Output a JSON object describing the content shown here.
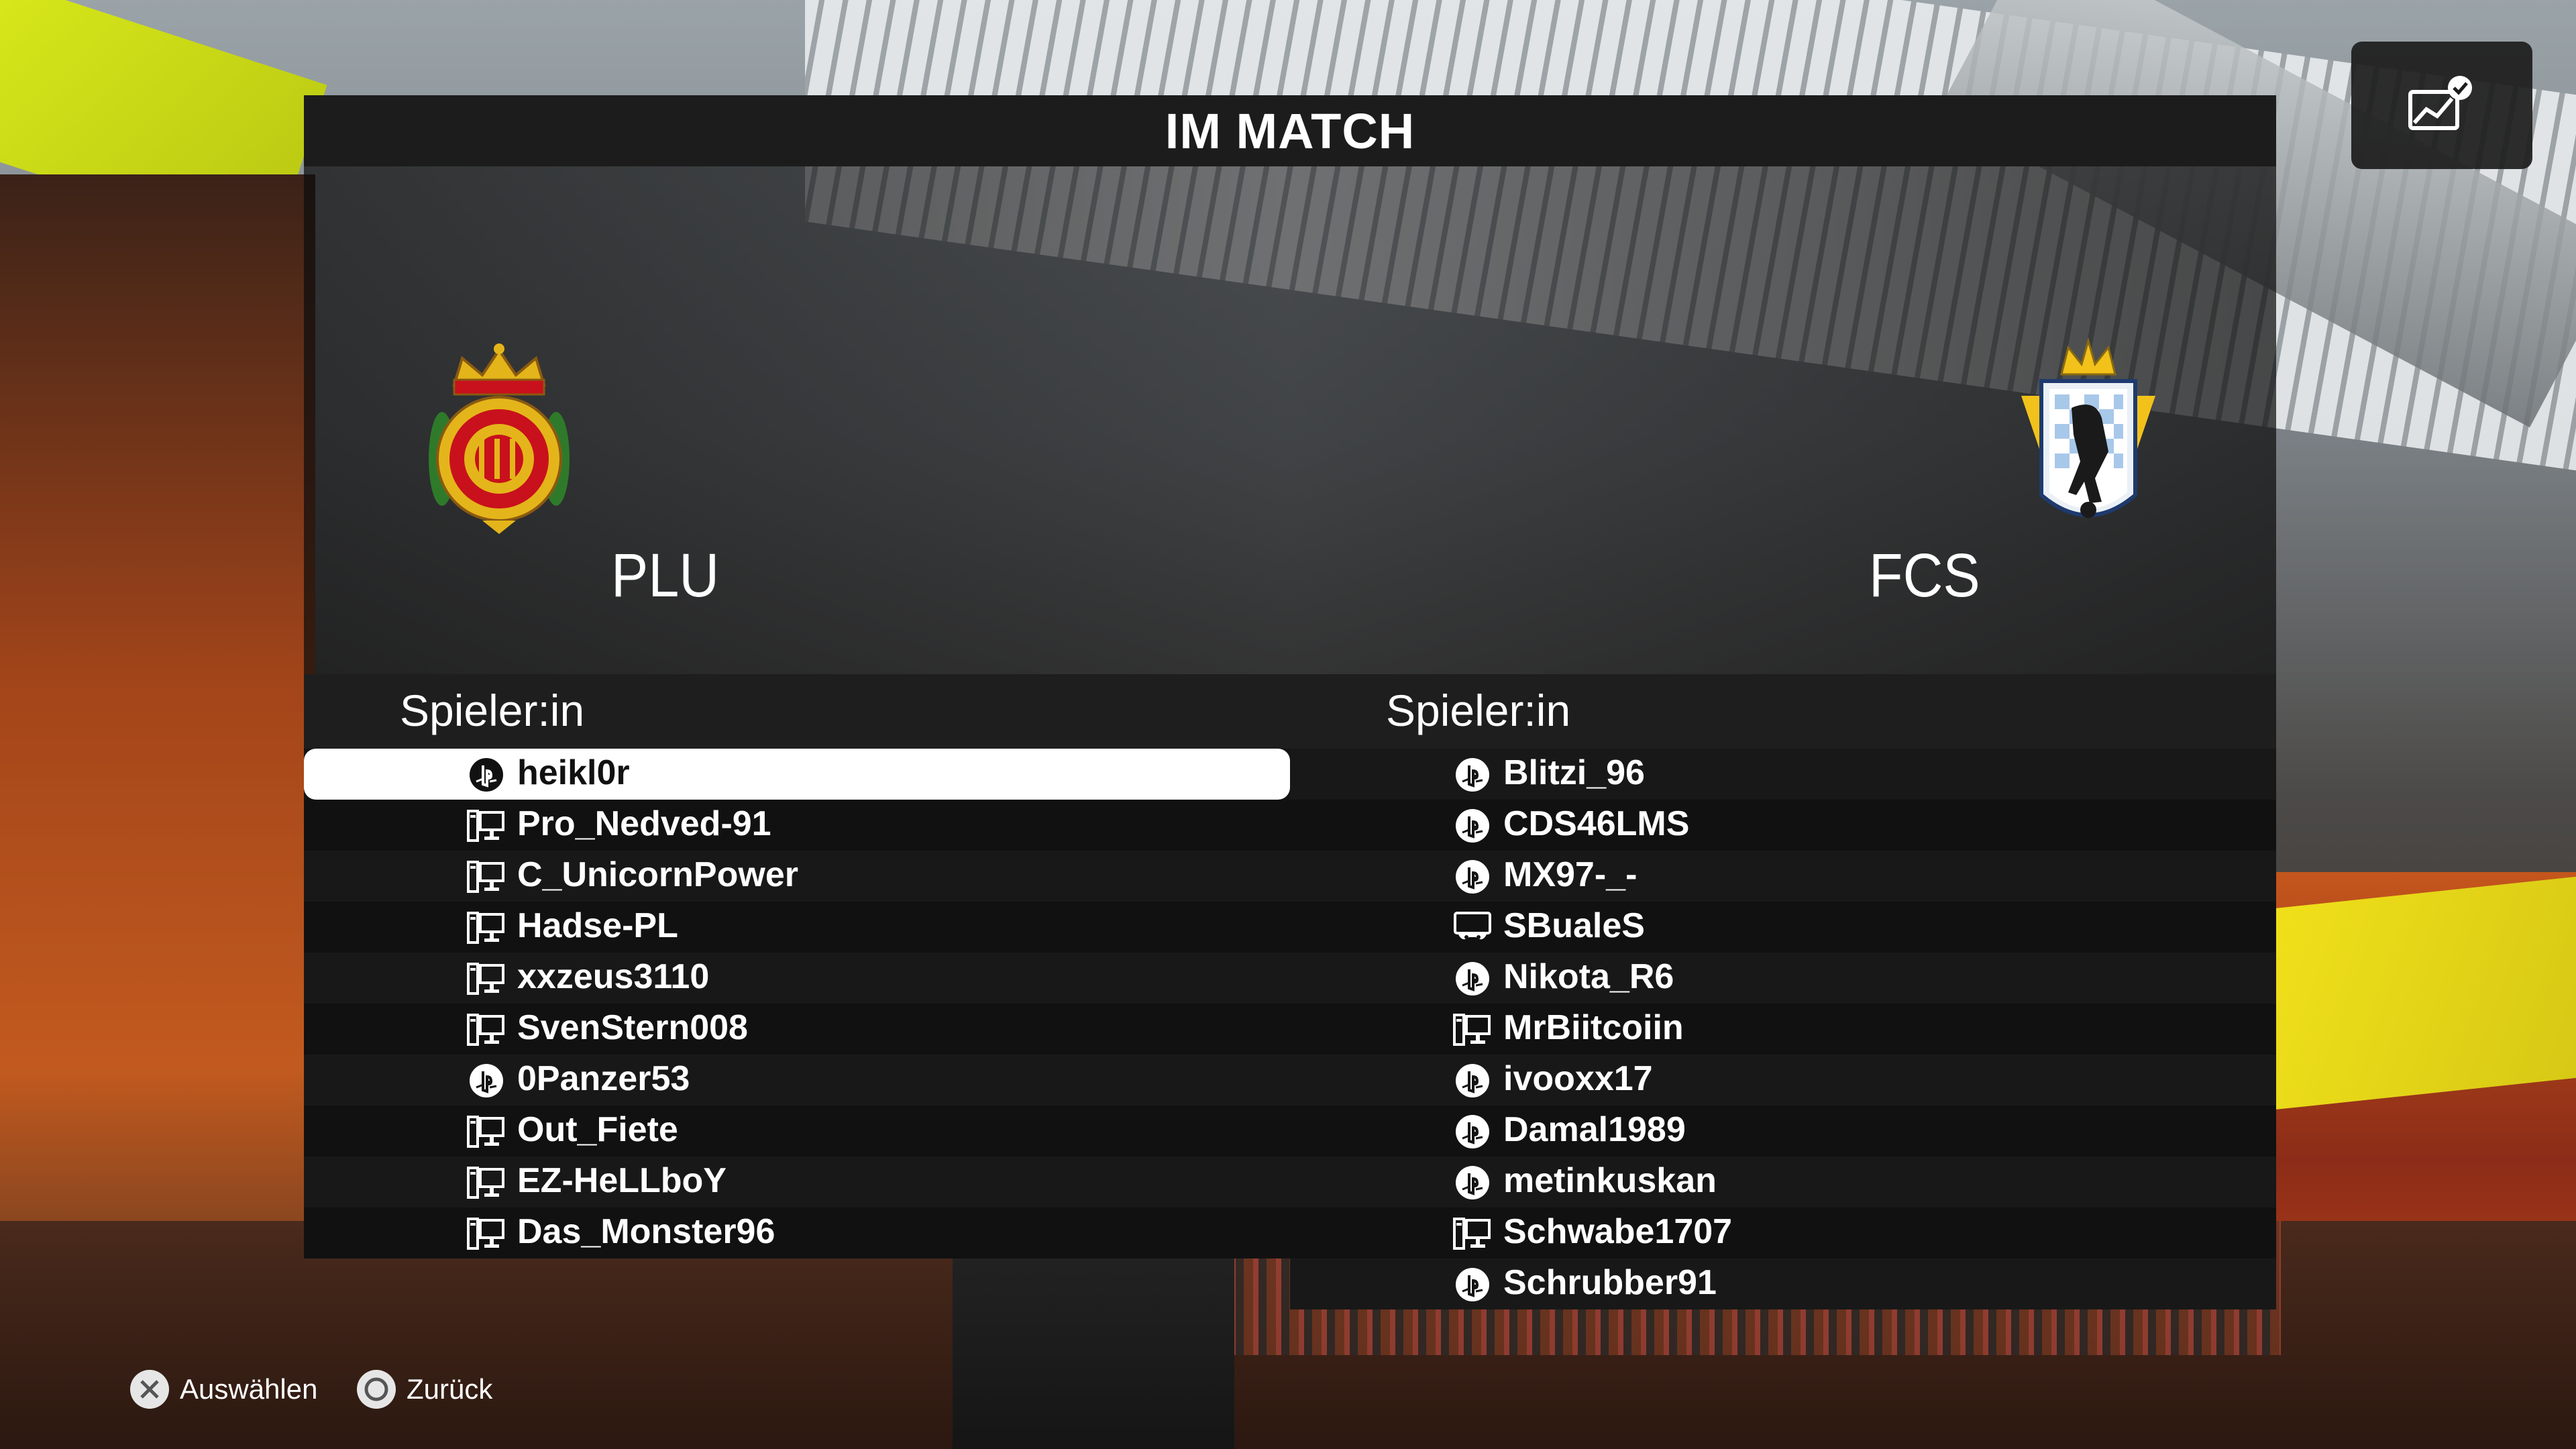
{
  "screen": {
    "title": "IM MATCH"
  },
  "teams": {
    "home": {
      "name": "PLU",
      "crest": "mallorca-crest-icon"
    },
    "away": {
      "name": "FCS",
      "crest": "fc-crest-icon"
    }
  },
  "lists": {
    "left": {
      "header": "Spieler:in",
      "players": [
        {
          "name": "heikl0r",
          "platform": "playstation-icon",
          "selected": true
        },
        {
          "name": "Pro_Nedved-91",
          "platform": "pc-icon"
        },
        {
          "name": "C_UnicornPower",
          "platform": "pc-icon"
        },
        {
          "name": "Hadse-PL",
          "platform": "pc-icon"
        },
        {
          "name": "xxzeus3110",
          "platform": "pc-icon"
        },
        {
          "name": "SvenStern008",
          "platform": "pc-icon"
        },
        {
          "name": "0Panzer53",
          "platform": "playstation-icon"
        },
        {
          "name": "Out_Fiete",
          "platform": "pc-icon"
        },
        {
          "name": "EZ-HeLLboY",
          "platform": "pc-icon"
        },
        {
          "name": "Das_Monster96",
          "platform": "pc-icon"
        }
      ]
    },
    "right": {
      "header": "Spieler:in",
      "players": [
        {
          "name": "Blitzi_96",
          "platform": "playstation-icon"
        },
        {
          "name": "CDS46LMS",
          "platform": "playstation-icon"
        },
        {
          "name": "MX97-_-",
          "platform": "playstation-icon"
        },
        {
          "name": "SBualeS",
          "platform": "controller-icon"
        },
        {
          "name": "Nikota_R6",
          "platform": "playstation-icon"
        },
        {
          "name": "MrBiitcoiin",
          "platform": "pc-icon"
        },
        {
          "name": "ivooxx17",
          "platform": "playstation-icon"
        },
        {
          "name": "Damal1989",
          "platform": "playstation-icon"
        },
        {
          "name": "metinkuskan",
          "platform": "playstation-icon"
        },
        {
          "name": "Schwabe1707",
          "platform": "pc-icon"
        },
        {
          "name": "Schrubber91",
          "platform": "playstation-icon"
        }
      ]
    }
  },
  "footer": {
    "select": {
      "label": "Auswählen",
      "icon": "cross-button-icon"
    },
    "back": {
      "label": "Zurück",
      "icon": "circle-button-icon"
    }
  },
  "corner_button": {
    "icon": "performance-check-icon"
  }
}
